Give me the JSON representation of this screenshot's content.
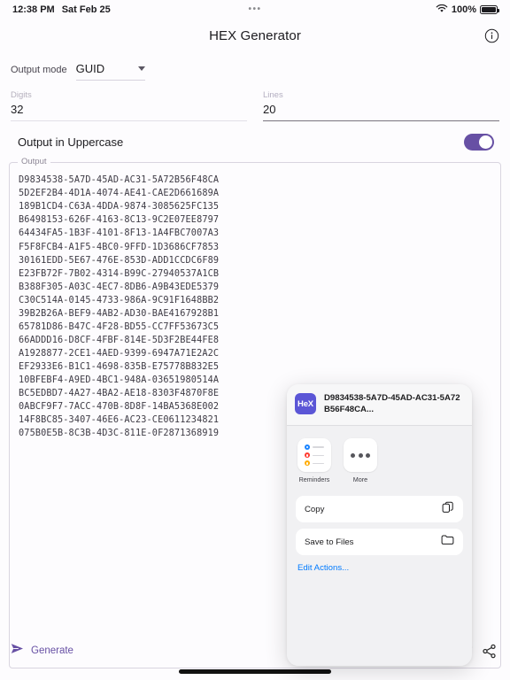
{
  "status_bar": {
    "time": "12:38 PM",
    "date": "Sat Feb 25",
    "center_dots": "•••",
    "battery_percent": "100%",
    "wifi_icon": "wifi-icon",
    "battery_icon": "battery-full-icon"
  },
  "app_bar": {
    "title": "HEX Generator",
    "info_icon": "info-circle-icon"
  },
  "form": {
    "output_mode_label": "Output mode",
    "output_mode_value": "GUID",
    "output_mode_options": [
      "GUID"
    ],
    "digits_label": "Digits",
    "digits_value": "32",
    "lines_label": "Lines",
    "lines_value": "20",
    "uppercase_label": "Output in Uppercase",
    "uppercase_on": true,
    "accent_color": "#6750a4"
  },
  "output": {
    "legend": "Output",
    "lines": [
      "D9834538-5A7D-45AD-AC31-5A72B56F48CA",
      "5D2EF2B4-4D1A-4074-AE41-CAE2D661689A",
      "189B1CD4-C63A-4DDA-9874-3085625FC135",
      "B6498153-626F-4163-8C13-9C2E07EE8797",
      "64434FA5-1B3F-4101-8F13-1A4FBC7007A3",
      "F5F8FCB4-A1F5-4BC0-9FFD-1D3686CF7853",
      "30161EDD-5E67-476E-853D-ADD1CCDC6F89",
      "E23FB72F-7B02-4314-B99C-27940537A1CB",
      "B388F305-A03C-4EC7-8DB6-A9B43EDE5379",
      "C30C514A-0145-4733-986A-9C91F1648BB2",
      "39B2B26A-BEF9-4AB2-AD30-BAE4167928B1",
      "65781D86-B47C-4F28-BD55-CC7FF53673C5",
      "66ADDD16-D8CF-4FBF-814E-5D3F2BE44FE8",
      "A1928877-2CE1-4AED-9399-6947A71E2A2C",
      "EF2933E6-B1C1-4698-835B-E75778B832E5",
      "10BFEBF4-A9ED-4BC1-948A-03651980514A",
      "BC5EDBD7-4A27-4BA2-AE18-8303F4870F8E",
      "0ABCF9F7-7ACC-470B-8D8F-14BA5368E002",
      "14F8BC85-3407-46E6-AC23-CE0611234821",
      "075B0E5B-8C3B-4D3C-811E-0F2871368919"
    ]
  },
  "bottom_bar": {
    "generate_label": "Generate",
    "generate_icon": "send-arrow-icon",
    "share_icon": "share-icon"
  },
  "share_sheet": {
    "app_icon_text": "HeX",
    "title": "D9834538-5A7D-45AD-AC31-5A72B56F48CA...",
    "apps": [
      {
        "label": "Reminders",
        "icon": "reminders-icon"
      },
      {
        "label": "More",
        "icon": "more-dots-icon"
      }
    ],
    "actions": [
      {
        "label": "Copy",
        "icon": "copy-icon"
      },
      {
        "label": "Save to Files",
        "icon": "folder-icon"
      }
    ],
    "edit_actions_label": "Edit Actions...",
    "edit_actions_color": "#007aff"
  }
}
